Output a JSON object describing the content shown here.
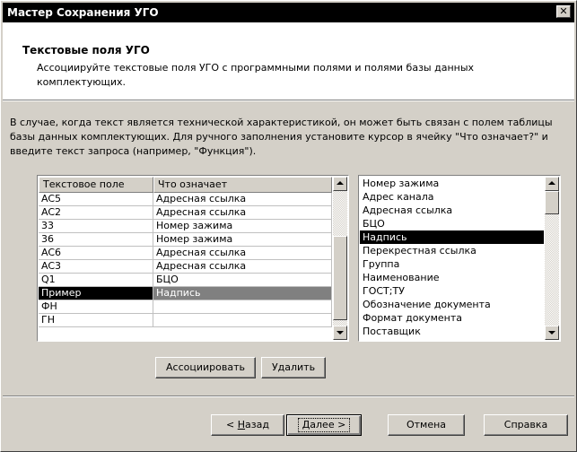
{
  "window": {
    "title": "Мастер Сохранения УГО",
    "close_glyph": "✕"
  },
  "header": {
    "title": "Текстовые поля УГО",
    "subtitle": "Ассоциируйте текстовые поля УГО с программными полями и полями базы данных комплектующих."
  },
  "description": "В случае, когда текст является технической характеристикой, он может быть связан с полем таблицы базы данных комплектующих. Для ручного заполнения установите курсор в ячейку \"Что означает?\" и введите текст запроса (например, \"Функция\").",
  "grid": {
    "columns": [
      "Текстовое поле",
      "Что означает"
    ],
    "rows": [
      [
        "AC5",
        "Адресная ссылка"
      ],
      [
        "AC2",
        "Адресная ссылка"
      ],
      [
        "33",
        "Номер зажима"
      ],
      [
        "36",
        "Номер зажима"
      ],
      [
        "AC6",
        "Адресная ссылка"
      ],
      [
        "AC3",
        "Адресная ссылка"
      ],
      [
        "Q1",
        "БЦО"
      ],
      [
        "Пример",
        "Надпись"
      ],
      [
        "ФН",
        ""
      ],
      [
        "ГН",
        ""
      ]
    ],
    "selected_row": 7
  },
  "field_list": {
    "items": [
      "Номер зажима",
      "Адрес канала",
      "Адресная ссылка",
      "БЦО",
      "Надпись",
      "Перекрестная ссылка",
      "Группа",
      "Наименование",
      "ГОСТ;ТУ",
      "Обозначение документа",
      "Формат документа",
      "Поставщик"
    ],
    "selected_index": 4
  },
  "buttons": {
    "associate": "Ассоциировать",
    "delete": "Удалить",
    "back_prefix": "< ",
    "back_hotkey": "Н",
    "back_rest": "азад",
    "next_hotkey": "Д",
    "next_rest": "алее >",
    "cancel": "Отмена",
    "help": "Справка"
  },
  "colors": {
    "dialog_bg": "#d4d0c8",
    "titlebar": "#000000",
    "selection": "#000000"
  }
}
